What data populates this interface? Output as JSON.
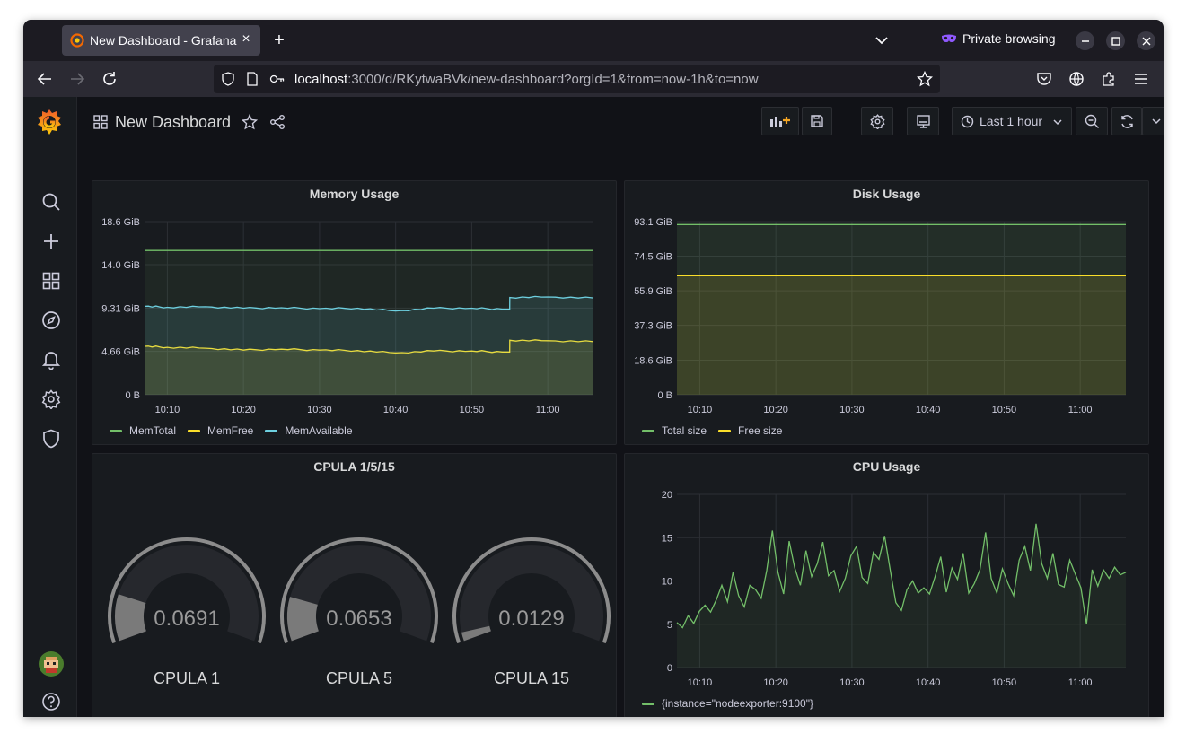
{
  "browser": {
    "tab_title": "New Dashboard - Grafana",
    "private_label": "Private browsing",
    "url_host": "localhost",
    "url_rest": ":3000/d/RKytwaBVk/new-dashboard?orgId=1&from=now-1h&to=now"
  },
  "dashboard": {
    "title": "New Dashboard",
    "time_range": "Last 1 hour"
  },
  "colors": {
    "green": "#73bf69",
    "yellow": "#fade2a",
    "blue": "#5794f2",
    "cyan": "#6ed0e0",
    "grafana_orange": "#f46800"
  },
  "panels": {
    "memory": {
      "title": "Memory Usage",
      "y_ticks": [
        "18.6 GiB",
        "14.0 GiB",
        "9.31 GiB",
        "4.66 GiB",
        "0 B"
      ],
      "x_ticks": [
        "10:10",
        "10:20",
        "10:30",
        "10:40",
        "10:50",
        "11:00"
      ],
      "legend": [
        "MemTotal",
        "MemFree",
        "MemAvailable"
      ]
    },
    "disk": {
      "title": "Disk Usage",
      "y_ticks": [
        "93.1 GiB",
        "74.5 GiB",
        "55.9 GiB",
        "37.3 GiB",
        "18.6 GiB",
        "0 B"
      ],
      "x_ticks": [
        "10:10",
        "10:20",
        "10:30",
        "10:40",
        "10:50",
        "11:00"
      ],
      "legend": [
        "Total size",
        "Free size"
      ]
    },
    "cpula": {
      "title": "CPULA 1/5/15",
      "gauges": [
        {
          "label": "CPULA 1",
          "value": "0.0691",
          "fraction": 0.173
        },
        {
          "label": "CPULA 5",
          "value": "0.0653",
          "fraction": 0.163
        },
        {
          "label": "CPULA 15",
          "value": "0.0129",
          "fraction": 0.032
        }
      ]
    },
    "cpu": {
      "title": "CPU Usage",
      "y_ticks": [
        "20",
        "15",
        "10",
        "5",
        "0"
      ],
      "x_ticks": [
        "10:10",
        "10:20",
        "10:30",
        "10:40",
        "10:50",
        "11:00"
      ],
      "legend": [
        "{instance=\"nodeexporter:9100\"}"
      ]
    }
  },
  "chart_data": [
    {
      "type": "line",
      "title": "Memory Usage",
      "x": [
        "10:07",
        "10:10",
        "10:15",
        "10:20",
        "10:25",
        "10:30",
        "10:35",
        "10:40",
        "10:45",
        "10:50",
        "10:54",
        "10:55",
        "11:00",
        "11:06"
      ],
      "ylim": [
        0,
        18.6
      ],
      "series": [
        {
          "name": "MemTotal",
          "values": [
            15.5,
            15.5,
            15.5,
            15.5,
            15.5,
            15.5,
            15.5,
            15.5,
            15.5,
            15.5,
            15.5,
            15.5,
            15.5,
            15.5
          ]
        },
        {
          "name": "MemFree",
          "values": [
            5.2,
            5.1,
            5.0,
            4.8,
            4.9,
            4.8,
            4.75,
            4.5,
            4.7,
            4.7,
            4.6,
            5.85,
            5.8,
            5.7
          ]
        },
        {
          "name": "MemAvailable",
          "values": [
            9.5,
            9.4,
            9.45,
            9.3,
            9.35,
            9.25,
            9.3,
            9.0,
            9.3,
            9.3,
            9.2,
            10.45,
            10.5,
            10.4
          ]
        }
      ]
    },
    {
      "type": "line",
      "title": "Disk Usage",
      "x": [
        "10:07",
        "11:06"
      ],
      "ylim": [
        0,
        93.1
      ],
      "series": [
        {
          "name": "Total size",
          "values": [
            91.5,
            91.5
          ]
        },
        {
          "name": "Free size",
          "values": [
            64.0,
            64.0
          ]
        }
      ]
    },
    {
      "type": "line",
      "title": "CPU Usage",
      "ylim": [
        0,
        20
      ],
      "x_start": "10:07",
      "x_end": "11:06",
      "series": [
        {
          "name": "{instance=\"nodeexporter:9100\"}",
          "values": [
            5.2,
            4.6,
            6.0,
            5.1,
            6.5,
            7.2,
            6.4,
            7.8,
            9.5,
            7.6,
            11.0,
            8.3,
            7.0,
            9.5,
            9.0,
            8.0,
            11.2,
            15.8,
            11.0,
            8.5,
            14.6,
            11.5,
            9.5,
            13.5,
            10.5,
            12.0,
            14.5,
            10.6,
            11.2,
            8.8,
            10.3,
            12.9,
            14.0,
            10.4,
            9.7,
            13.3,
            12.5,
            15.2,
            11.3,
            7.5,
            6.6,
            9.0,
            10.0,
            8.6,
            9.2,
            8.5,
            10.5,
            12.8,
            8.7,
            11.5,
            10.2,
            13.2,
            8.6,
            9.7,
            11.3,
            15.6,
            10.3,
            8.6,
            11.4,
            9.7,
            8.3,
            12.4,
            14.0,
            11.2,
            16.6,
            12.0,
            10.3,
            13.2,
            9.6,
            9.3,
            12.4,
            10.8,
            9.2,
            5.0,
            11.3,
            9.4,
            11.3,
            10.3,
            11.6,
            10.7,
            11.0
          ]
        }
      ]
    },
    {
      "type": "gauge",
      "title": "CPULA 1/5/15",
      "categories": [
        "CPULA 1",
        "CPULA 5",
        "CPULA 15"
      ],
      "values": [
        0.0691,
        0.0653,
        0.0129
      ]
    }
  ]
}
